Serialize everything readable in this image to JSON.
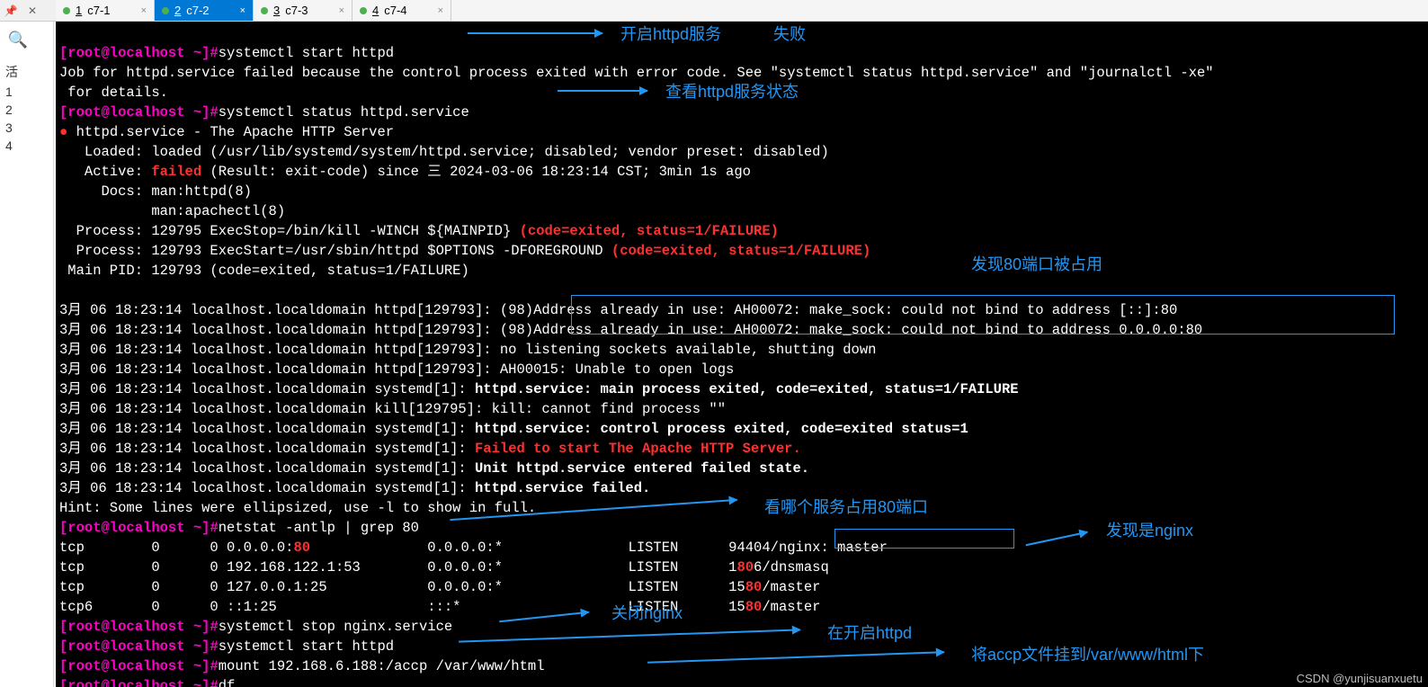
{
  "toolbar": {
    "pin_icon": "📌",
    "close_icon": "✕"
  },
  "tabs": [
    {
      "num": "1",
      "label": "c7-1",
      "active": false
    },
    {
      "num": "2",
      "label": "c7-2",
      "active": true
    },
    {
      "num": "3",
      "label": "c7-3",
      "active": false
    },
    {
      "num": "4",
      "label": "c7-4",
      "active": false
    }
  ],
  "sidebar": {
    "search_icon": "🔍",
    "items": [
      "活",
      "1",
      "2",
      "3",
      "4"
    ]
  },
  "term": {
    "prompt": "[root@localhost ~]#",
    "cmd1": "systemctl start httpd",
    "err1": "Job for httpd.service failed because the control process exited with error code. See \"systemctl status httpd.service\" and \"journalctl -xe\"",
    "err2": " for details.",
    "cmd2": "systemctl status httpd.service",
    "svc_title": " httpd.service - The Apache HTTP Server",
    "loaded": "   Loaded: loaded (/usr/lib/systemd/system/httpd.service; disabled; vendor preset: disabled)",
    "active_pre": "   Active: ",
    "active_fail": "failed",
    "active_post": " (Result: exit-code) since 三 2024-03-06 18:23:14 CST; 3min 1s ago",
    "docs1": "     Docs: man:httpd(8)",
    "docs2": "           man:apachectl(8)",
    "proc1_pre": "  Process: 129795 ExecStop=/bin/kill -WINCH ${MAINPID} ",
    "proc1_fail": "(code=exited, status=1/FAILURE)",
    "proc2_pre": "  Process: 129793 ExecStart=/usr/sbin/httpd $OPTIONS -DFOREGROUND ",
    "proc2_fail": "(code=exited, status=1/FAILURE)",
    "mainpid": " Main PID: 129793 (code=exited, status=1/FAILURE)",
    "log1_pre": "3月 06 18:23:14 localhost.localdomain httpd[129793]: ",
    "log1": "(98)Address already in use: AH00072: make_sock: could not bind to address [::]:80",
    "log2": "(98)Address already in use: AH00072: make_sock: could not bind to address 0.0.0.0:80",
    "log3": "3月 06 18:23:14 localhost.localdomain httpd[129793]: no listening sockets available, shutting down",
    "log4": "3月 06 18:23:14 localhost.localdomain httpd[129793]: AH00015: Unable to open logs",
    "log5_pre": "3月 06 18:23:14 localhost.localdomain systemd[1]: ",
    "log5": "httpd.service: main process exited, code=exited, status=1/FAILURE",
    "log6": "3月 06 18:23:14 localhost.localdomain kill[129795]: kill: cannot find process \"\"",
    "log7": "httpd.service: control process exited, code=exited status=1",
    "log8": "Failed to start The Apache HTTP Server.",
    "log9": "Unit httpd.service entered failed state.",
    "log10": "httpd.service failed.",
    "hint": "Hint: Some lines were ellipsized, use -l to show in full.",
    "cmd3": "netstat -antlp | grep 80",
    "net1_a": "tcp        0      0 0.0.0.0:",
    "net1_80": "80",
    "net1_b": "              0.0.0.0:*               LISTEN      94404/nginx: master ",
    "net2_a": "tcp        0      0 192.168.122.1:53        0.0.0.0:*               LISTEN      1",
    "net2_80": "80",
    "net2_b": "6/dnsmasq        ",
    "net3_a": "tcp        0      0 127.0.0.1:25            0.0.0.0:*               LISTEN      15",
    "net3_80": "80",
    "net3_b": "/master         ",
    "net4_a": "tcp6       0      0 ::1:25                  :::*                    LISTEN      15",
    "net4_80": "80",
    "net4_b": "/master         ",
    "cmd4": "systemctl stop nginx.service",
    "cmd5": "systemctl start httpd",
    "cmd6": "mount 192.168.6.188:/accp /var/www/html",
    "cmd7": "df"
  },
  "annot": {
    "a1": "开启httpd服务",
    "a1b": "失败",
    "a2": "查看httpd服务状态",
    "a3": "发现80端口被占用",
    "a4": "看哪个服务占用80端口",
    "a5": "发现是nginx",
    "a6": "关闭nginx",
    "a7": "在开启httpd",
    "a8": "将accp文件挂到/var/www/html下"
  },
  "watermark": "CSDN @yunjisuanxuetu"
}
